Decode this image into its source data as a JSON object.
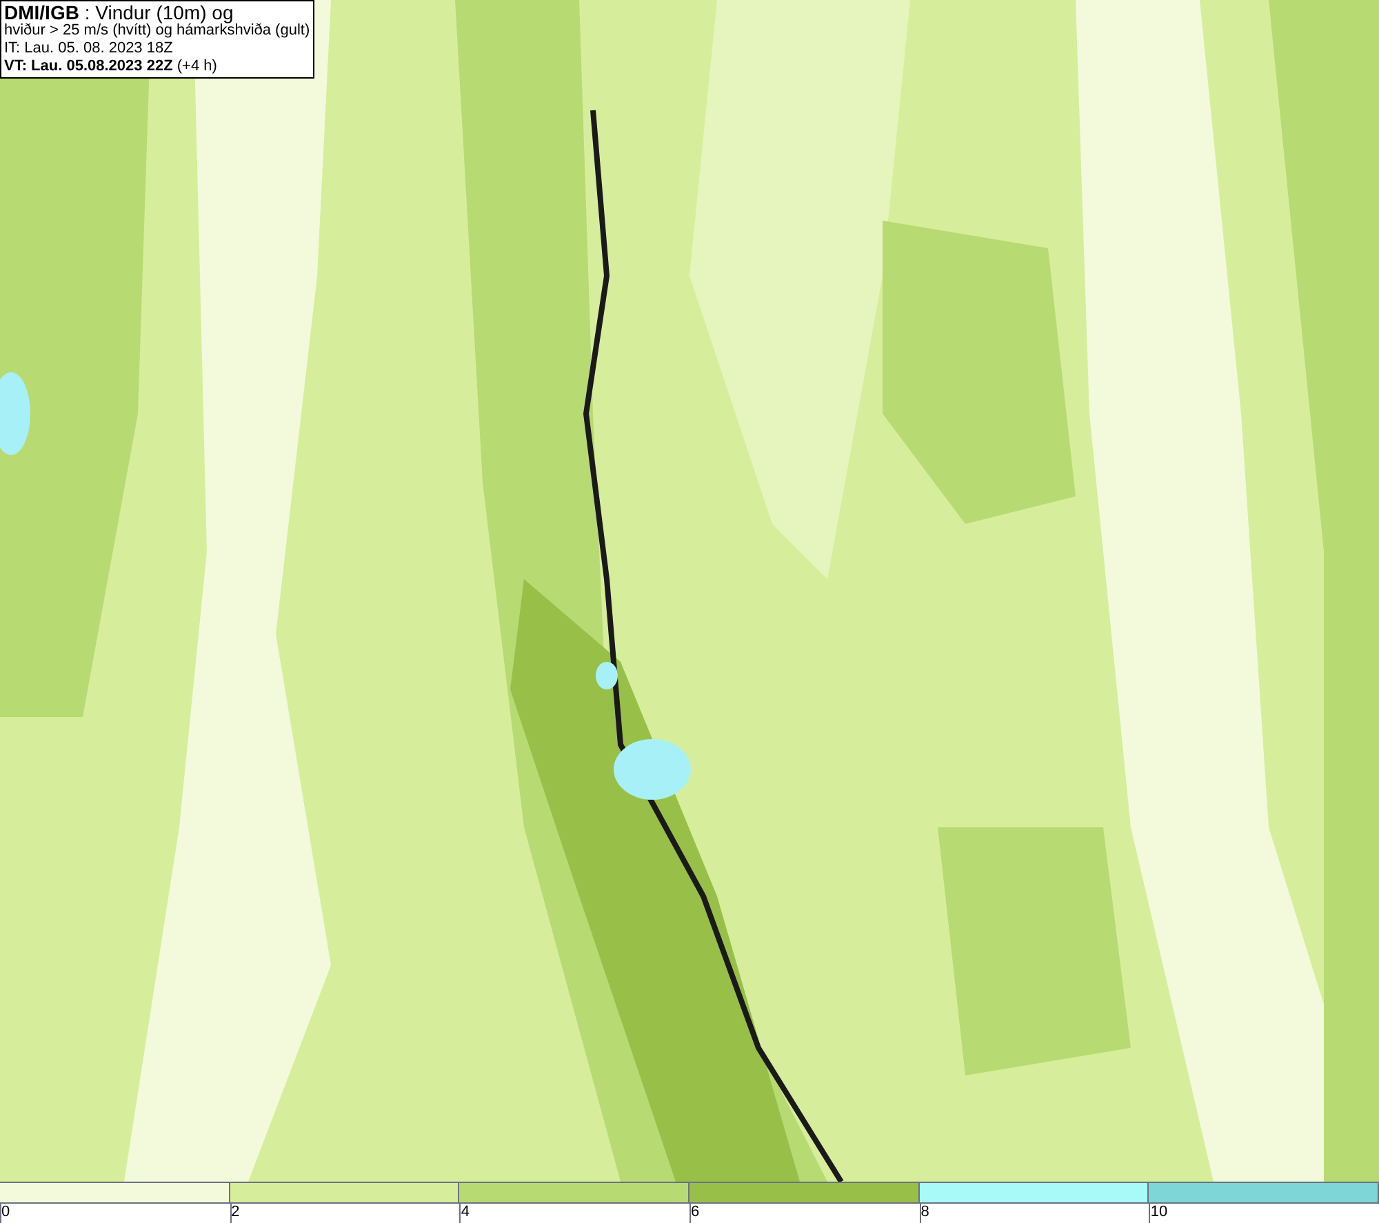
{
  "header": {
    "lines": [
      "**DMI/IGB** : Vindur (10m) og",
      "hviður > 25 m/s (hvítt) og hámarkshviða (gult)",
      "IT: Lau. 05. 08. 2023 18Z",
      "**VT: Lau. 05.08.2023 22Z** (+4 h)"
    ]
  },
  "legend": {
    "bins": [
      {
        "color": "#f3fadb"
      },
      {
        "color": "#d6ee9c"
      },
      {
        "color": "#b8da72"
      },
      {
        "color": "#98c048"
      },
      {
        "color": "#a8faf8"
      },
      {
        "color": "#7fd6d6"
      }
    ],
    "ticks": [
      "0",
      "2",
      "4",
      "6",
      "8",
      "10"
    ]
  }
}
